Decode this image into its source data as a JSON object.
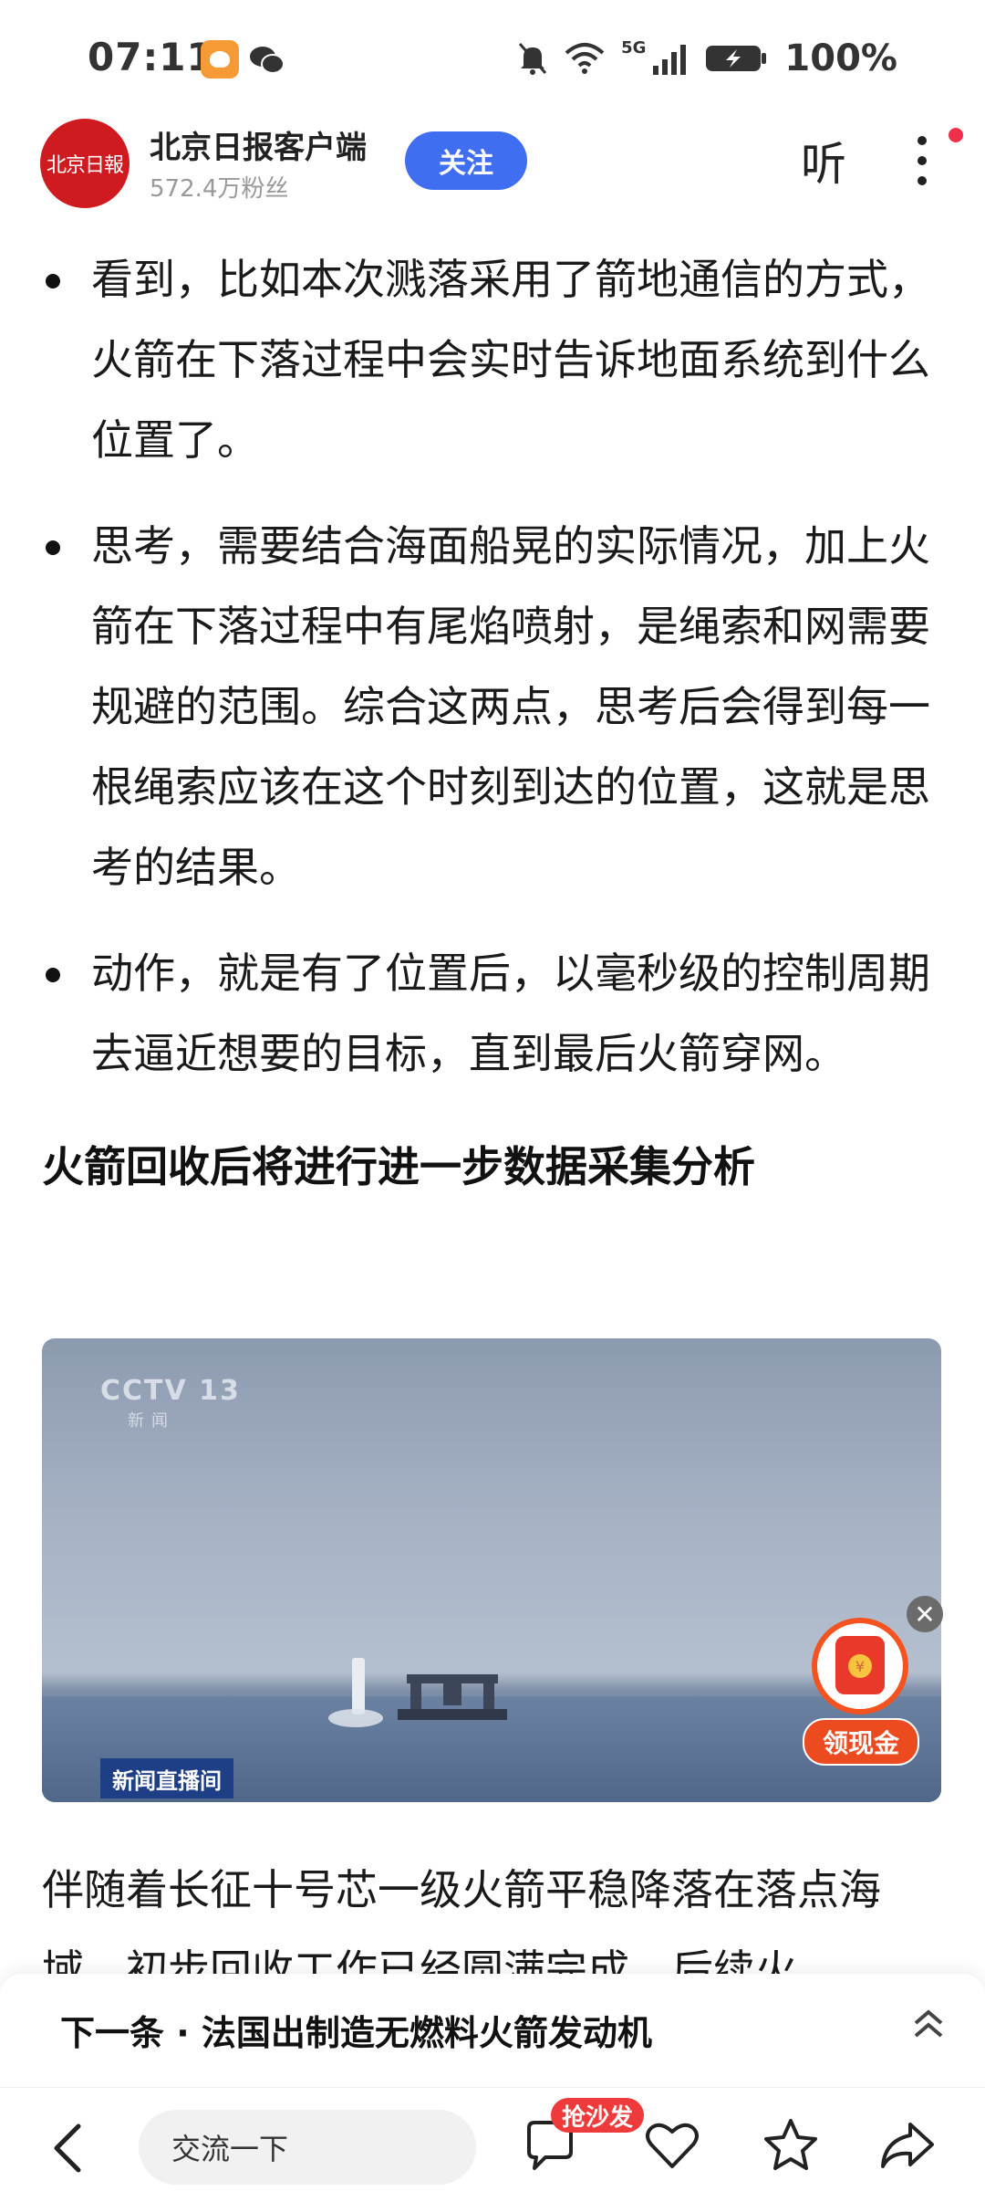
{
  "status_bar": {
    "time": "07:11",
    "network": "5G",
    "battery_percent": "100%"
  },
  "header": {
    "logo_text": "北京日報",
    "publisher": "北京日报客户端",
    "fans": "572.4万粉丝",
    "follow_label": "关注",
    "listen_label": "听"
  },
  "article": {
    "bullets": [
      "看到，比如本次溅落采用了箭地通信的方式，火箭在下落过程中会实时告诉地面系统到什么位置了。",
      "思考，需要结合海面船晃的实际情况，加上火箭在下落过程中有尾焰喷射，是绳索和网需要规避的范围。综合这两点，思考后会得到每一根绳索应该在这个时刻到达的位置，这就是思考的结果。",
      "动作，就是有了位置后，以毫秒级的控制周期去逼近想要的目标，直到最后火箭穿网。"
    ],
    "subheading": "火箭回收后将进行进一步数据采集分析",
    "figure": {
      "channel_logo": "CCTV 13",
      "channel_sub": "新闻",
      "live_tag": "新闻直播间"
    },
    "paragraph": "伴随着长征十号芯一级火箭平稳降落在落点海域，初步回收工作已经圆满完成，后续火"
  },
  "promo": {
    "cash_label": "领现金",
    "close_symbol": "✕"
  },
  "next_article": {
    "label": "下一条 · 法国出制造无燃料火箭发动机"
  },
  "bottom_bar": {
    "comment_placeholder": "交流一下",
    "sofa_badge": "抢沙发"
  }
}
